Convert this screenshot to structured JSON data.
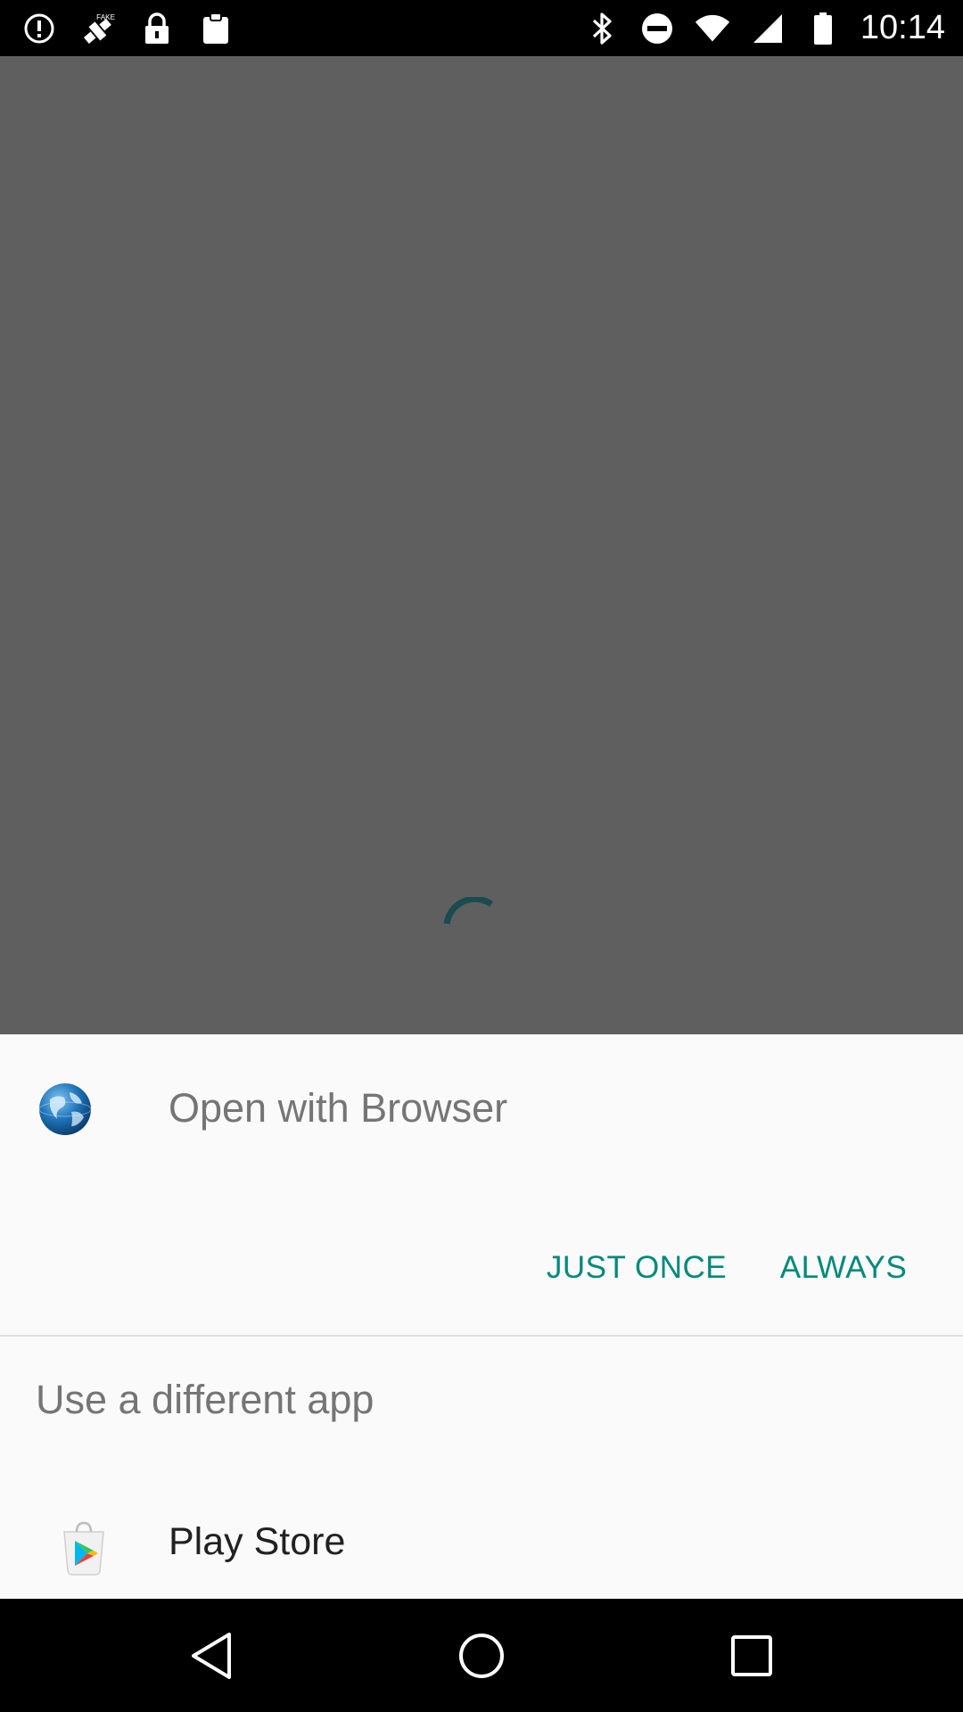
{
  "status_bar": {
    "time": "10:14",
    "left_icons": [
      "alert-circle-icon",
      "fake-gps-icon",
      "lock-icon",
      "clipboard-icon"
    ],
    "right_icons": [
      "bluetooth-icon",
      "do-not-disturb-icon",
      "wifi-icon",
      "signal-icon",
      "battery-icon"
    ],
    "fake_badge": "FAKE"
  },
  "background": {
    "color": "#5f5f5f",
    "spinner_color": "#1a4b4f"
  },
  "dialog": {
    "title": "Open with Browser",
    "icon": "globe-browser-icon",
    "buttons": {
      "just_once": "JUST ONCE",
      "always": "ALWAYS"
    },
    "accent_color": "#00897b",
    "different_app_label": "Use a different app",
    "apps": [
      {
        "name": "Play Store",
        "icon": "play-store-icon"
      }
    ]
  },
  "nav_bar": {
    "buttons": [
      "back-icon",
      "home-icon",
      "recents-icon"
    ]
  }
}
